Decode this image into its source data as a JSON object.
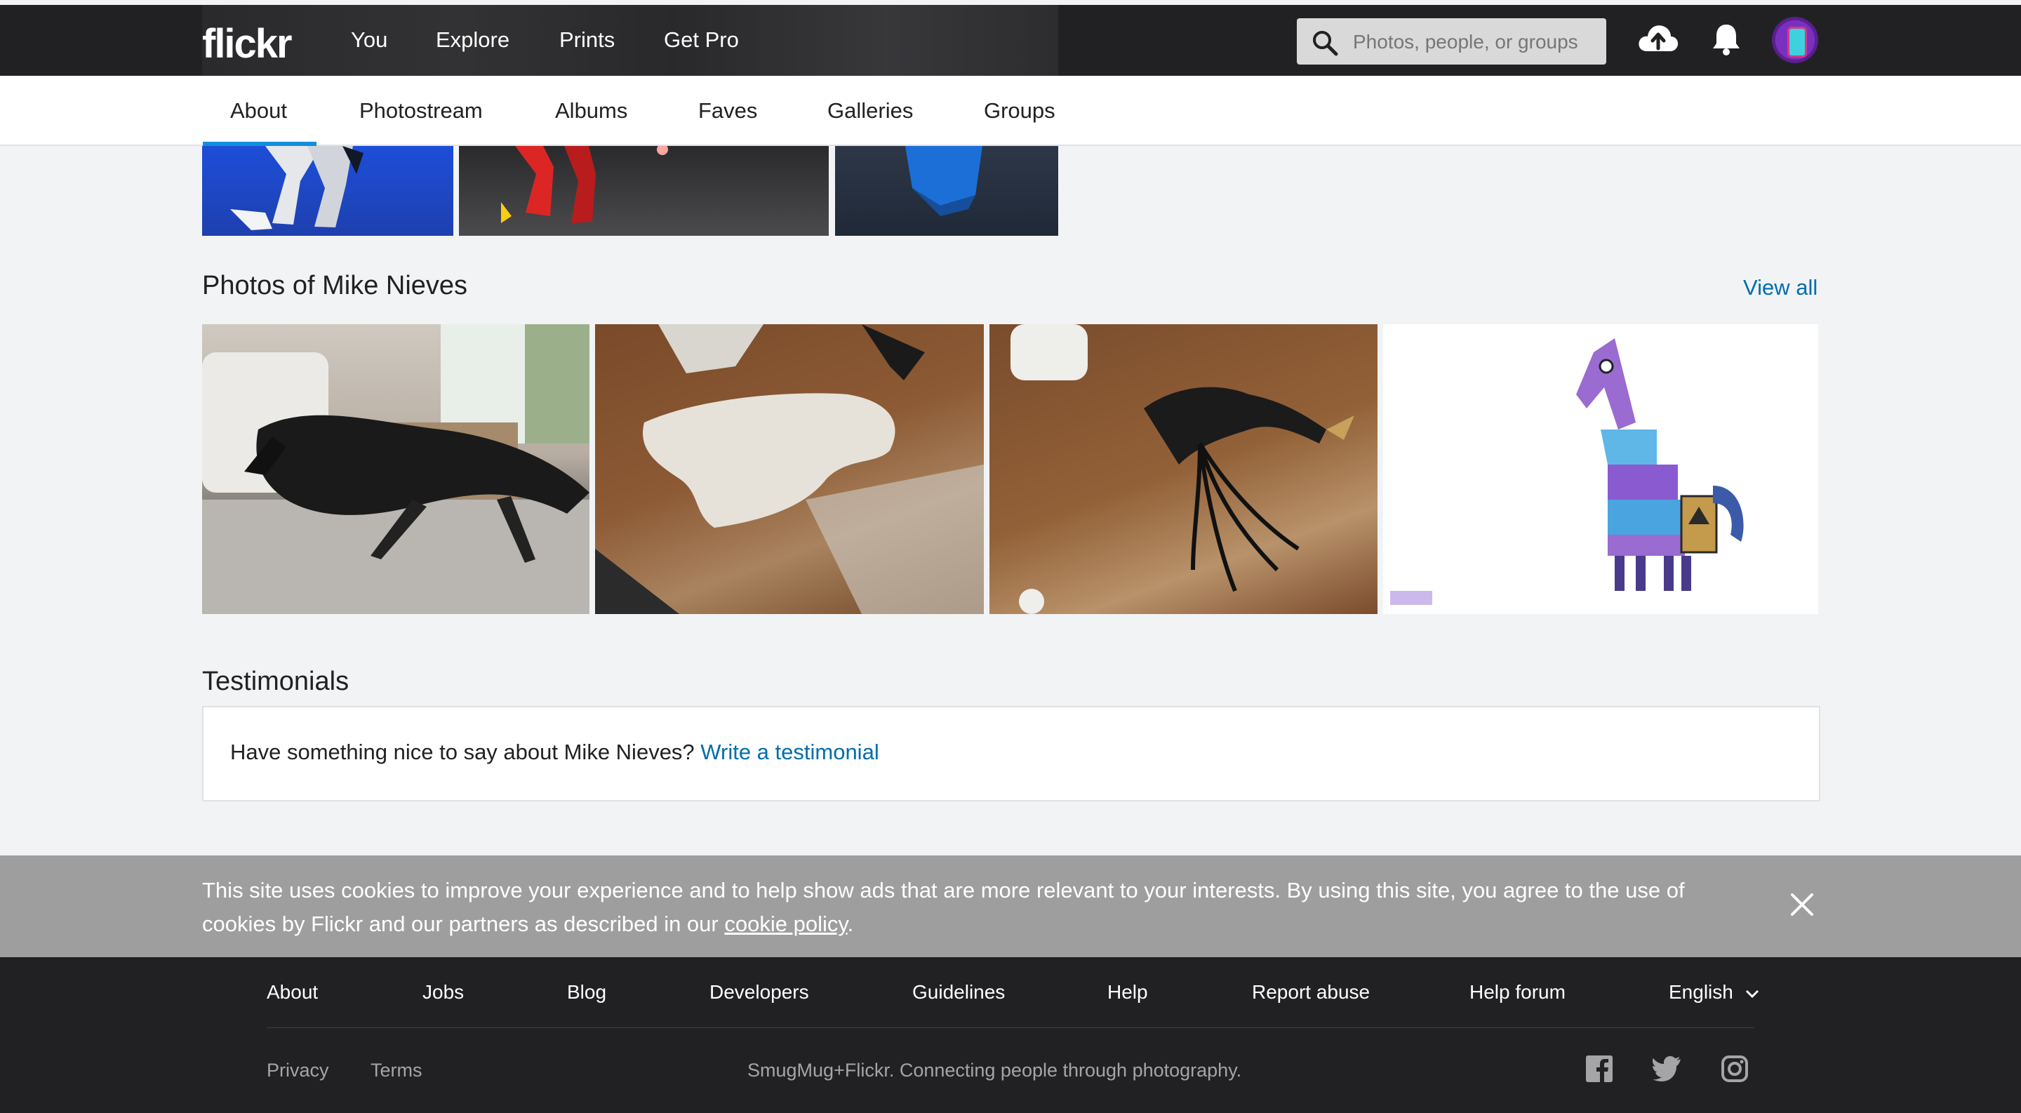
{
  "header": {
    "logo": "flickr",
    "nav": [
      "You",
      "Explore",
      "Prints",
      "Get Pro"
    ],
    "search_placeholder": "Photos, people, or groups"
  },
  "subnav": {
    "tabs": [
      "About",
      "Photostream",
      "Albums",
      "Faves",
      "Galleries",
      "Groups"
    ],
    "active": "About"
  },
  "photos_section": {
    "title": "Photos of Mike Nieves",
    "view_all": "View all"
  },
  "testimonials": {
    "title": "Testimonials",
    "prompt": "Have something nice to say about Mike Nieves?",
    "link": "Write a testimonial"
  },
  "cookie_banner": {
    "text": "This site uses cookies to improve your experience and to help show ads that are more relevant to your interests. By using this site, you agree to the use of cookies by Flickr and our partners as described in our",
    "link": "cookie policy",
    "end": "."
  },
  "footer": {
    "links": [
      "About",
      "Jobs",
      "Blog",
      "Developers",
      "Guidelines",
      "Help",
      "Report abuse",
      "Help forum"
    ],
    "language": "English",
    "legal": [
      "Privacy",
      "Terms"
    ],
    "tagline": "SmugMug+Flickr. Connecting people through photography."
  },
  "colors": {
    "accent_link": "#006dac",
    "active_tab": "#128fdc",
    "header_bg": "#212124"
  }
}
